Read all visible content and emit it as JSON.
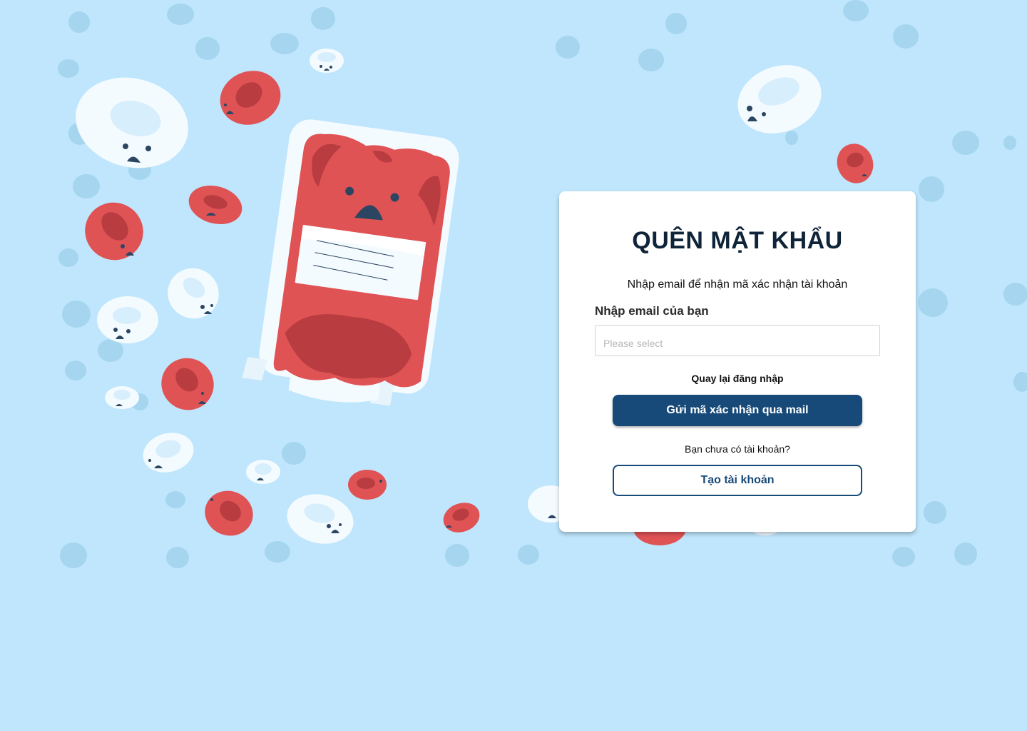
{
  "form": {
    "title": "QUÊN MẬT KHẨU",
    "subtitle": "Nhập email để nhận mã xác nhận tài khoản",
    "email_label": "Nhập email của bạn",
    "email_placeholder": "Please select",
    "email_value": "",
    "back_to_login": "Quay lại đăng nhập",
    "send_button": "Gửi mã xác nhận qua mail",
    "no_account_text": "Bạn chưa có tài khoản?",
    "create_account_button": "Tạo tài khoản"
  },
  "colors": {
    "background": "#bfe6fc",
    "primary": "#174a78",
    "blood_red": "#e05355",
    "blood_dark": "#b83c40",
    "white_cell": "#f4fbff",
    "dot": "#a5d5ef"
  },
  "illustration": {
    "main": "blood-bag-icon",
    "decorations": [
      "red-blood-cell-icon",
      "white-blood-cell-icon",
      "background-dot"
    ]
  }
}
